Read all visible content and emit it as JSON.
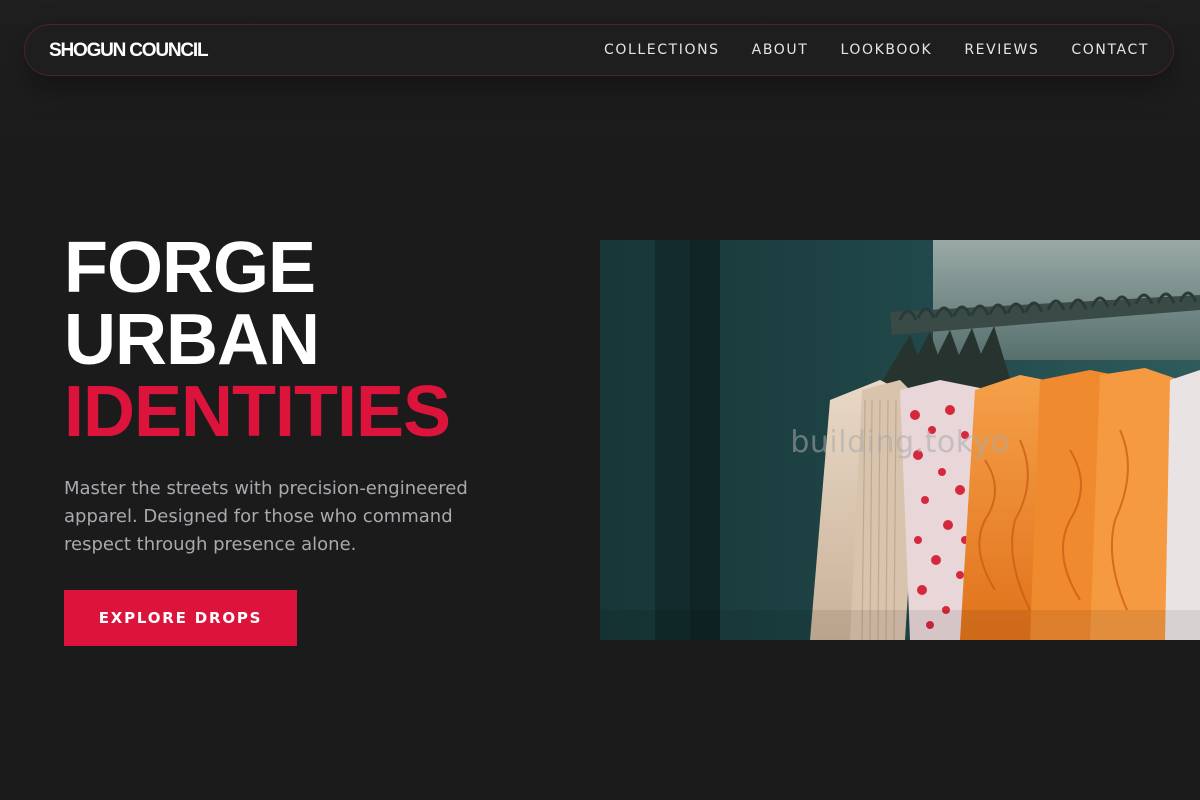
{
  "nav": {
    "brand": "SHOGUN COUNCIL",
    "links": [
      "COLLECTIONS",
      "ABOUT",
      "LOOKBOOK",
      "REVIEWS",
      "CONTACT"
    ]
  },
  "hero": {
    "title_lines": [
      "FORGE",
      "URBAN",
      "IDENTITIES"
    ],
    "description": "Master the streets with precision-engineered apparel. Designed for those who command respect through presence alone.",
    "cta_label": "EXPLORE DROPS",
    "image": {
      "subject": "clothing rack with hanging garments",
      "watermark": "building.tokyo"
    }
  },
  "colors": {
    "background": "#1b1b1c",
    "accent": "#dc143c",
    "text": "#ffffff",
    "muted_text": "#a9a9ae",
    "nav_border": "#4a2230"
  }
}
